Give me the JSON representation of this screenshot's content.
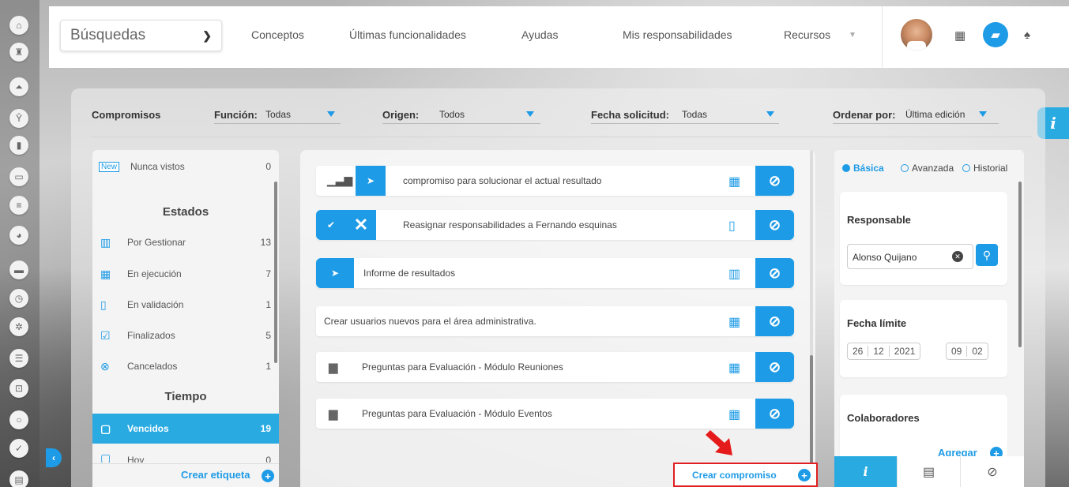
{
  "topbar": {
    "search_select": "Búsquedas",
    "nav": [
      "Conceptos",
      "Últimas funcionalidades",
      "Ayudas",
      "Mis responsabilidades",
      "Recursos"
    ]
  },
  "filters": {
    "title": "Compromisos",
    "funcion_label": "Función:",
    "funcion_value": "Todas",
    "origen_label": "Origen:",
    "origen_value": "Todos",
    "fecha_label": "Fecha solicitud:",
    "fecha_value": "Todas",
    "orden_label": "Ordenar por:",
    "orden_value": "Última edición"
  },
  "sidebar": {
    "new_badge": "New",
    "nunca_vistos": {
      "label": "Nunca vistos",
      "count": "0"
    },
    "estados_heading": "Estados",
    "estados": [
      {
        "label": "Por Gestionar",
        "count": "13",
        "icon": "calendar-icon"
      },
      {
        "label": "En ejecución",
        "count": "7",
        "icon": "calendar-grid-icon"
      },
      {
        "label": "En validación",
        "count": "1",
        "icon": "document-search-icon"
      },
      {
        "label": "Finalizados",
        "count": "5",
        "icon": "checkbox-icon"
      },
      {
        "label": "Cancelados",
        "count": "1",
        "icon": "cancel-circle-icon"
      }
    ],
    "tiempo_heading": "Tiempo",
    "tiempo": [
      {
        "label": "Vencidos",
        "count": "19",
        "icon": "calendar-icon"
      },
      {
        "label": "Hoy",
        "count": "0",
        "icon": "calendar-icon"
      }
    ],
    "create_label": "Crear etiqueta"
  },
  "items": [
    {
      "title": "compromiso para solucionar el actual resultado"
    },
    {
      "title": "Reasignar responsabilidades a Fernando esquinas"
    },
    {
      "title": "Informe de resultados"
    },
    {
      "title": "Crear usuarios nuevos para el área administrativa."
    },
    {
      "title": "Preguntas para Evaluación - Módulo Reuniones"
    },
    {
      "title": "Preguntas para Evaluación - Módulo Eventos"
    }
  ],
  "create_commitment": "Crear compromiso",
  "right": {
    "radios": [
      "Básica",
      "Avanzada",
      "Historial"
    ],
    "responsable_title": "Responsable",
    "responsable_value": "Alonso Quijano",
    "fecha_title": "Fecha límite",
    "date": [
      "26",
      "12",
      "2021"
    ],
    "time": [
      "09",
      "02"
    ],
    "colaboradores_title": "Colaboradores",
    "agregar": "Agregar"
  },
  "colors": {
    "accent": "#1e9be6",
    "highlight": "#e02020"
  }
}
